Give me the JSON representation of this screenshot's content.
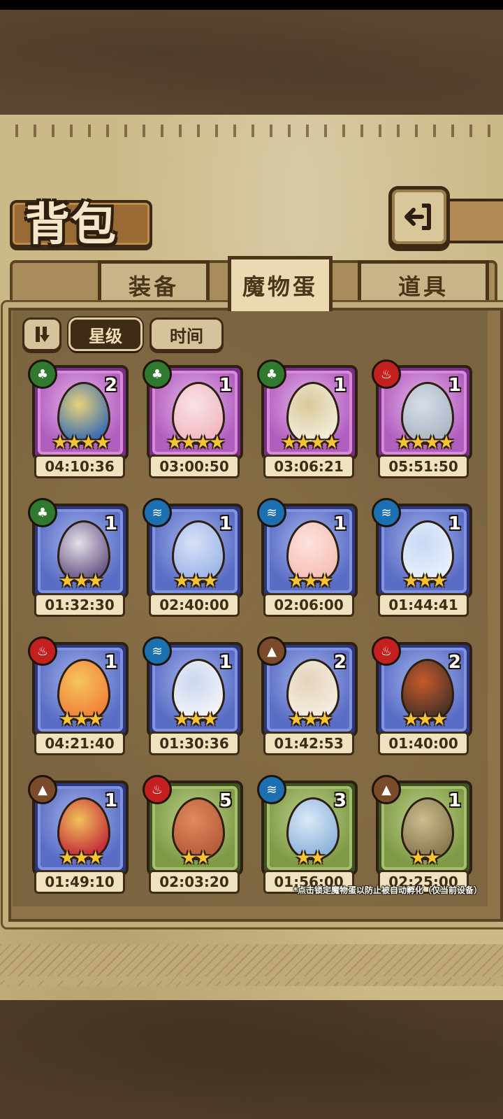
{
  "title": "背包",
  "tabs": [
    {
      "label": "装备",
      "active": false
    },
    {
      "label": "魔物蛋",
      "active": true
    },
    {
      "label": "道具",
      "active": false
    }
  ],
  "filters": {
    "sort_icon": "sort-order-icon",
    "star_label": "星级",
    "time_label": "时间"
  },
  "eggs": [
    {
      "element": "grass",
      "count": "2",
      "stars": "★★★★",
      "timer": "04:10:36",
      "frame": "purple"
    },
    {
      "element": "grass",
      "count": "1",
      "stars": "★★★★",
      "timer": "03:00:50",
      "frame": "purple"
    },
    {
      "element": "grass",
      "count": "1",
      "stars": "★★★★",
      "timer": "03:06:21",
      "frame": "purple"
    },
    {
      "element": "fire",
      "count": "1",
      "stars": "★★★★",
      "timer": "05:51:50",
      "frame": "purple"
    },
    {
      "element": "grass",
      "count": "1",
      "stars": "★★★",
      "timer": "01:32:30",
      "frame": "blue"
    },
    {
      "element": "water",
      "count": "1",
      "stars": "★★★",
      "timer": "02:40:00",
      "frame": "blue"
    },
    {
      "element": "water",
      "count": "1",
      "stars": "★★★",
      "timer": "02:06:00",
      "frame": "blue"
    },
    {
      "element": "water",
      "count": "1",
      "stars": "★★★",
      "timer": "01:44:41",
      "frame": "blue"
    },
    {
      "element": "fire",
      "count": "1",
      "stars": "★★★",
      "timer": "04:21:40",
      "frame": "blue"
    },
    {
      "element": "water",
      "count": "1",
      "stars": "★★★",
      "timer": "01:30:36",
      "frame": "blue"
    },
    {
      "element": "earth",
      "count": "2",
      "stars": "★★★",
      "timer": "01:42:53",
      "frame": "blue"
    },
    {
      "element": "fire",
      "count": "2",
      "stars": "★★★",
      "timer": "01:40:00",
      "frame": "blue"
    },
    {
      "element": "earth",
      "count": "1",
      "stars": "★★★",
      "timer": "01:49:10",
      "frame": "blue"
    },
    {
      "element": "fire",
      "count": "5",
      "stars": "★★",
      "timer": "02:03:20",
      "frame": "green"
    },
    {
      "element": "water",
      "count": "3",
      "stars": "★★",
      "timer": "01:56:00",
      "frame": "green"
    },
    {
      "element": "earth",
      "count": "1",
      "stars": "★★",
      "timer": "02:25:00",
      "frame": "green"
    }
  ],
  "hint": "*点击锁定魔物蛋以防止被自动孵化（仅当前设备）",
  "colors": {
    "parchment": "#cbb987",
    "panel": "#7b6440",
    "fire": "#c42020",
    "water": "#1c6fb0",
    "grass": "#2f7a2e",
    "earth": "#7a4a2a"
  }
}
